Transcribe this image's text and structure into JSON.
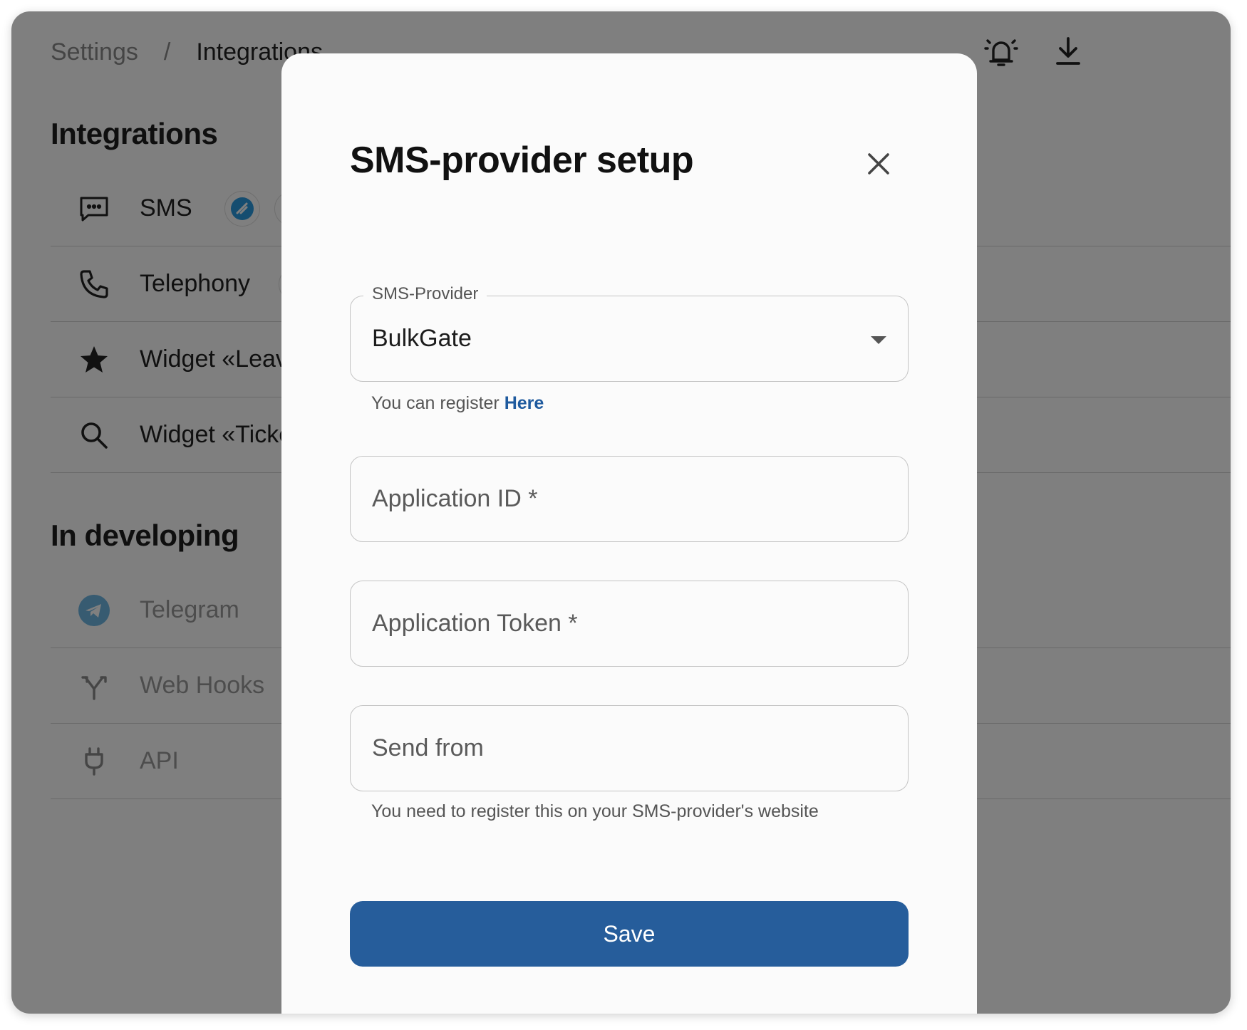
{
  "breadcrumb": {
    "root": "Settings",
    "separator": "/",
    "current": "Integrations"
  },
  "header_icons": {
    "alarm": "alarm-bell-icon",
    "download": "download-icon"
  },
  "integrations": {
    "title": "Integrations",
    "items": [
      {
        "label": "SMS",
        "icon": "chat-icon"
      },
      {
        "label": "Telephony",
        "icon": "phone-icon"
      },
      {
        "label": "Widget «Leave",
        "icon": "star-icon"
      },
      {
        "label": "Widget «Ticke",
        "icon": "search-icon"
      }
    ]
  },
  "developing": {
    "title": "In developing",
    "items": [
      {
        "label": "Telegram",
        "icon": "telegram-icon"
      },
      {
        "label": "Web Hooks",
        "icon": "webhook-icon"
      },
      {
        "label": "API",
        "icon": "plug-icon"
      }
    ]
  },
  "modal": {
    "title": "SMS-provider setup",
    "provider_label": "SMS-Provider",
    "provider_value": "BulkGate",
    "register_text": "You can register",
    "register_link": "Here",
    "app_id_placeholder": "Application ID *",
    "app_token_placeholder": "Application Token *",
    "send_from_placeholder": "Send from",
    "send_from_helper": "You need to register this on your SMS-provider's website",
    "save_label": "Save"
  },
  "colors": {
    "primary": "#265d9b",
    "link": "#1e5a9e",
    "overlay": "rgba(0,0,0,0.5)"
  }
}
